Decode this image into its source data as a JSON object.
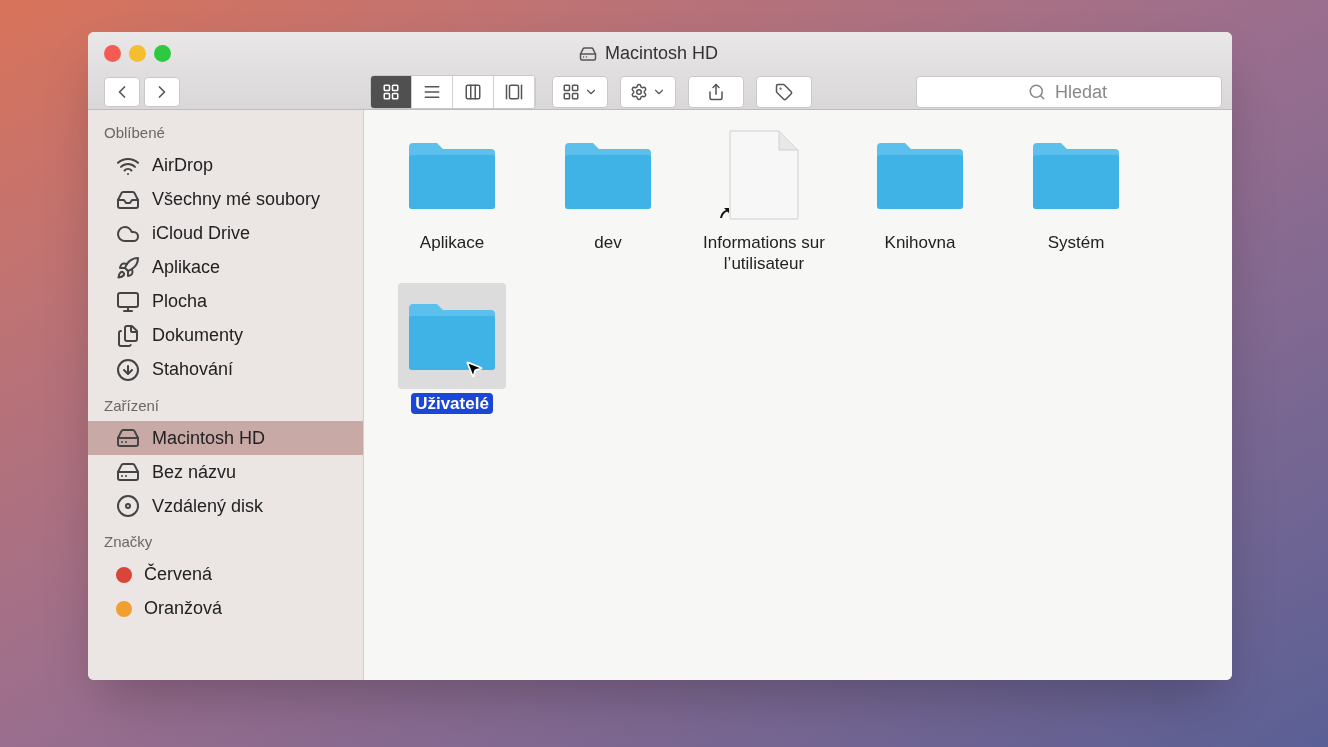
{
  "window": {
    "title": "Macintosh HD"
  },
  "toolbar": {
    "view_modes": [
      {
        "kind": "icons",
        "selected": true
      },
      {
        "kind": "list",
        "selected": false
      },
      {
        "kind": "columns",
        "selected": false
      },
      {
        "kind": "gallery",
        "selected": false
      }
    ]
  },
  "search": {
    "placeholder": "Hledat"
  },
  "sidebar": {
    "sections": [
      {
        "title": "Oblíbené",
        "items": [
          {
            "label": "AirDrop",
            "kind": "airdrop",
            "selected": false
          },
          {
            "label": "Všechny mé soubory",
            "kind": "allfiles",
            "selected": false
          },
          {
            "label": "iCloud Drive",
            "kind": "cloud",
            "selected": false
          },
          {
            "label": "Aplikace",
            "kind": "apps",
            "selected": false
          },
          {
            "label": "Plocha",
            "kind": "desktop",
            "selected": false
          },
          {
            "label": "Dokumenty",
            "kind": "documents",
            "selected": false
          },
          {
            "label": "Stahování",
            "kind": "downloads",
            "selected": false
          }
        ]
      },
      {
        "title": "Zařízení",
        "items": [
          {
            "label": "Macintosh HD",
            "kind": "harddisk",
            "selected": true
          },
          {
            "label": "Bez názvu",
            "kind": "drive",
            "selected": false
          },
          {
            "label": "Vzdálený disk",
            "kind": "disc",
            "selected": false
          }
        ]
      },
      {
        "title": "Značky",
        "items": [
          {
            "label": "Červená",
            "kind": "tag",
            "color": "#d9453b",
            "selected": false
          },
          {
            "label": "Oranžová",
            "kind": "tag",
            "color": "#f0a030",
            "selected": false
          }
        ]
      }
    ]
  },
  "files": [
    {
      "name": "Aplikace",
      "kind": "folder",
      "selected": false
    },
    {
      "name": "dev",
      "kind": "folder",
      "selected": false
    },
    {
      "name": "Informations sur l’utilisateur",
      "kind": "alias",
      "selected": false
    },
    {
      "name": "Knihovna",
      "kind": "folder",
      "selected": false
    },
    {
      "name": "Systém",
      "kind": "folder",
      "selected": false
    },
    {
      "name": "Uživatelé",
      "kind": "folder",
      "selected": true
    }
  ]
}
